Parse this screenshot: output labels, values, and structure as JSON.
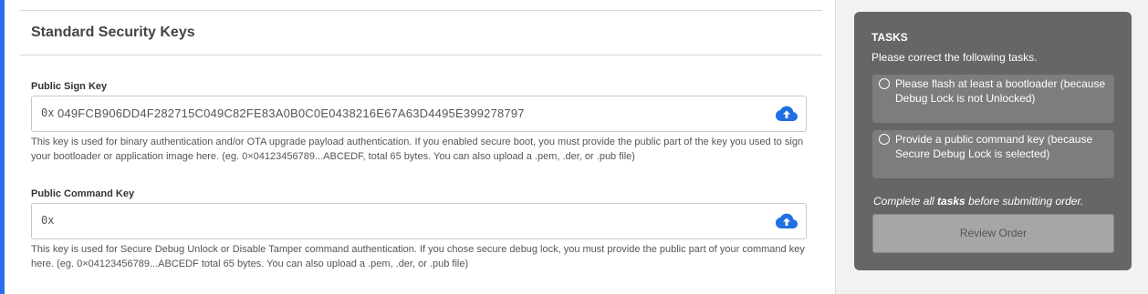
{
  "section": {
    "title": "Standard Security Keys"
  },
  "public_sign_key": {
    "label": "Public Sign Key",
    "prefix": "0x",
    "value": "049FCB906DD4F282715C049C82FE83A0B0C0E0438216E67A63D4495E399278797",
    "help": "This key is used for binary authentication and/or OTA upgrade payload authentication. If you enabled secure boot, you must provide the public part of the key you used to sign your bootloader or application image here. (eg. 0×04123456789...ABCEDF, total 65 bytes. You can also upload a .pem, .der, or .pub file)",
    "upload_icon": "cloud-upload-icon"
  },
  "public_command_key": {
    "label": "Public Command Key",
    "prefix": "0x",
    "value": "",
    "help": "This key is used for Secure Debug Unlock or Disable Tamper command authentication. If you chose secure debug lock, you must provide the public part of your command key here. (eg. 0×04123456789...ABCEDF total 65 bytes. You can also upload a .pem, .der, or .pub file)",
    "upload_icon": "cloud-upload-icon"
  },
  "tasks": {
    "heading": "TASKS",
    "intro": "Please correct the following tasks.",
    "items": [
      {
        "text": "Please flash at least a bootloader (because Debug Lock is not Unlocked)"
      },
      {
        "text": "Provide a public command key (because Secure Debug Lock is selected)"
      }
    ],
    "complete_note_prefix": "Complete all ",
    "complete_note_bold": "tasks",
    "complete_note_suffix": " before submitting order.",
    "review_button": "Review Order"
  },
  "colors": {
    "accent": "#2c6df0",
    "upload_icon": "#1f6fe5",
    "panel": "#666666",
    "task_item": "#7d7d7d",
    "button_disabled": "#a6a6a6"
  }
}
